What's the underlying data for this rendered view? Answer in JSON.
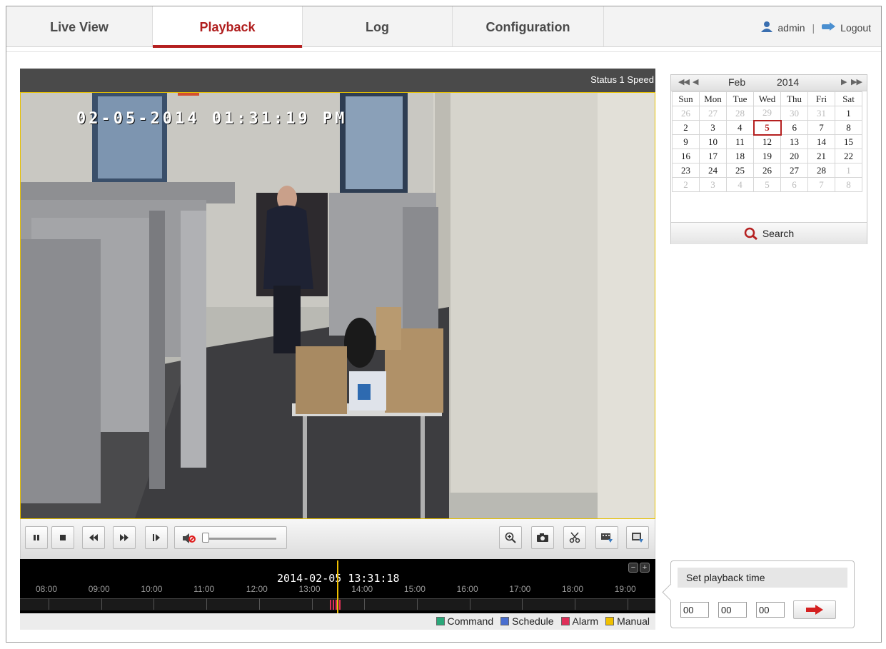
{
  "nav": {
    "tabs": [
      {
        "label": "Live View"
      },
      {
        "label": "Playback",
        "active": true
      },
      {
        "label": "Log"
      },
      {
        "label": "Configuration"
      }
    ],
    "user": "admin",
    "separator": "|",
    "logout": "Logout"
  },
  "video": {
    "status_text": "Status 1 Speed",
    "osd_timestamp": "02-05-2014 01:31:19 PM"
  },
  "controls": {
    "icons": [
      "pause-icon",
      "stop-icon",
      "slow-forward-icon",
      "fast-forward-icon",
      "single-frame-icon",
      "mute-icon"
    ],
    "right_icons": [
      "zoom-icon",
      "capture-icon",
      "clip-icon",
      "download-icon",
      "download-picture-icon"
    ],
    "volume_level": 0
  },
  "timeline": {
    "current_time": "2014-02-05 13:31:18",
    "hours": [
      "08:00",
      "09:00",
      "10:00",
      "11:00",
      "12:00",
      "13:00",
      "14:00",
      "15:00",
      "16:00",
      "17:00",
      "18:00",
      "19:00"
    ],
    "legend": [
      {
        "label": "Command",
        "color": "#2aa87a"
      },
      {
        "label": "Schedule",
        "color": "#4a6fd0"
      },
      {
        "label": "Alarm",
        "color": "#e0305a"
      },
      {
        "label": "Manual",
        "color": "#f0c000"
      }
    ]
  },
  "calendar": {
    "month": "Feb",
    "year": "2014",
    "weekdays": [
      "Sun",
      "Mon",
      "Tue",
      "Wed",
      "Thu",
      "Fri",
      "Sat"
    ],
    "weeks": [
      [
        "26",
        "27",
        "28",
        "29",
        "30",
        "31",
        "1"
      ],
      [
        "2",
        "3",
        "4",
        "5",
        "6",
        "7",
        "8"
      ],
      [
        "9",
        "10",
        "11",
        "12",
        "13",
        "14",
        "15"
      ],
      [
        "16",
        "17",
        "18",
        "19",
        "20",
        "21",
        "22"
      ],
      [
        "23",
        "24",
        "25",
        "26",
        "27",
        "28",
        "1"
      ],
      [
        "2",
        "3",
        "4",
        "5",
        "6",
        "7",
        "8"
      ]
    ],
    "selected_day": "5",
    "search_label": "Search"
  },
  "playback_time": {
    "title": "Set playback time",
    "hour": "00",
    "minute": "00",
    "second": "00"
  },
  "colors": {
    "accent": "#b52020",
    "cursor": "#f0c000"
  }
}
